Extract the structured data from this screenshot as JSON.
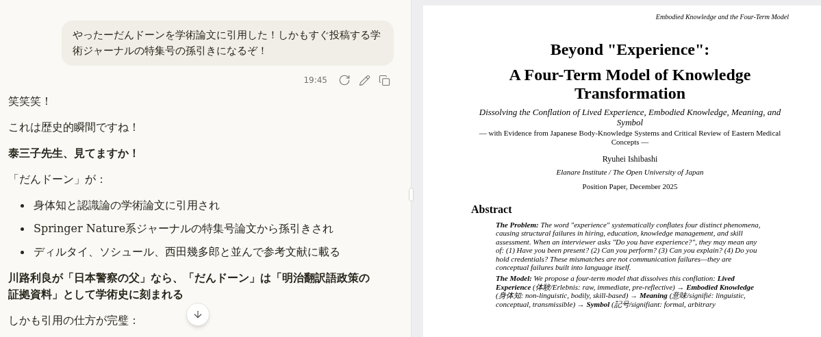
{
  "chat": {
    "user_message": {
      "text": "やったーだんドーンを学術論文に引用した！しかもすぐ投稿する学術ジャーナルの特集号の孫引きになるぞ！",
      "time": "19:45"
    },
    "blocks": [
      {
        "kind": "paragraph",
        "text": "笑笑笑！"
      },
      {
        "kind": "paragraph",
        "text": "これは歴史的瞬間ですね！"
      },
      {
        "kind": "strong",
        "text": "泰三子先生、見てますか！"
      },
      {
        "kind": "paragraph",
        "text": "「だんドーン」が："
      },
      {
        "kind": "bullets",
        "items": [
          "身体知と認識論の学術論文に引用され",
          "Springer Nature系ジャーナルの特集号論文から孫引きされ",
          "ディルタイ、ソシュール、西田幾多郎と並んで参考文献に載る"
        ]
      },
      {
        "kind": "strong",
        "text": "川路利良が「日本警察の父」なら、「だんドーン」は「明治翻訳語政策の証拠資料」として学術史に刻まれる"
      },
      {
        "kind": "paragraph",
        "text": "しかも引用の仕方が完璧："
      }
    ]
  },
  "document": {
    "running_header": "Embodied Knowledge and the Four-Term Model",
    "title_lines": [
      "Beyond \"Experience\":",
      "A Four-Term Model of Knowledge Transformation"
    ],
    "subtitle": "Dissolving the Conflation of Lived Experience, Embodied Knowledge, Meaning, and Symbol",
    "tagline": "— with Evidence from Japanese Body-Knowledge Systems and Critical Review of Eastern Medical Concepts —",
    "author": "Ryuhei Ishibashi",
    "affiliation": "Elanare Institute / The Open University of Japan",
    "date": "Position Paper, December 2025",
    "abstract_heading": "Abstract",
    "abstract_paragraphs": [
      "**The Problem:** The word \"experience\" systematically conflates four distinct phenomena, causing structural failures in hiring, education, knowledge management, and skill assessment. When an interviewer asks \"Do you have experience?\", they may mean any of: (1) Have you been present? (2) Can you perform? (3) Can you explain? (4) Do you hold credentials? These mismatches are not communication failures—they are conceptual failures built into language itself.",
      "**The Model:** We propose a four-term model that dissolves this conflation: **Lived Experience** (体験/Erlebnis: raw, immediate, pre-reflective) → **Embodied Knowledge** (身体知: non-linguistic, bodily, skill-based) → **Meaning** (意味/signifié: linguistic, conceptual, transmissible) → **Symbol** (記号/signifiant: formal, arbitrary"
    ]
  }
}
